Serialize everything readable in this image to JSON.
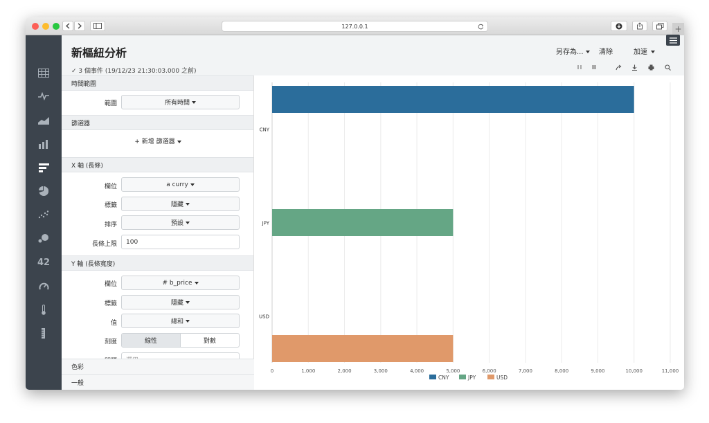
{
  "browser": {
    "url": "127.0.0.1",
    "back_icon": "chevron-left-icon",
    "forward_icon": "chevron-right-icon",
    "sidebar_icon": "sidebar-icon",
    "reload_icon": "reload-icon",
    "download_icon": "download-icon",
    "share_icon": "share-icon",
    "tabs_icon": "tabs-icon",
    "newtab_label": "+"
  },
  "nav": {
    "items": [
      {
        "icon": "table-icon"
      },
      {
        "icon": "line-chart-icon"
      },
      {
        "icon": "area-chart-icon"
      },
      {
        "icon": "column-chart-icon"
      },
      {
        "icon": "bar-chart-icon"
      },
      {
        "icon": "pie-chart-icon"
      },
      {
        "icon": "scatter-chart-icon"
      },
      {
        "icon": "bubble-chart-icon"
      },
      {
        "icon": "single-value-icon",
        "label": "42"
      },
      {
        "icon": "gauge-icon"
      },
      {
        "icon": "thermometer-icon"
      },
      {
        "icon": "marker-gauge-icon"
      }
    ]
  },
  "header": {
    "title": "新樞紐分析",
    "subtitle": "✓ 3 個事件 (19/12/23 21:30:03.000 之前)",
    "save_as": "另存為...",
    "clear": "清除",
    "accelerate": "加速",
    "menu_icon": "hamburger-icon",
    "tools": [
      "pause-icon",
      "stop-icon",
      "share-icon",
      "download-icon",
      "print-icon",
      "search-icon"
    ]
  },
  "panel": {
    "time_range_section": "時間範圍",
    "range_label": "範圍",
    "range_value": "所有時間",
    "filter_section": "篩選器",
    "add_filter": "+ 新增 篩選器",
    "x_section": "X 軸 (長條)",
    "x_field_label": "欄位",
    "x_field_value": "a curry",
    "x_label_label": "標籤",
    "x_label_value": "隱藏",
    "x_sort_label": "排序",
    "x_sort_value": "預設",
    "x_limit_label": "長條上限",
    "x_limit_value": "100",
    "y_section": "Y 軸 (長條寬度)",
    "y_field_label": "欄位",
    "y_field_value": "# b_price",
    "y_label_label": "標籤",
    "y_label_value": "隱藏",
    "y_value_label": "值",
    "y_value_value": "總和",
    "y_scale_label": "刻度",
    "y_scale_linear": "線性",
    "y_scale_log": "對數",
    "y_interval_label": "間隔",
    "y_interval_value": "選用",
    "color_section": "色彩",
    "general_section": "一般"
  },
  "chart_data": {
    "type": "bar",
    "orientation": "horizontal",
    "categories": [
      "CNY",
      "JPY",
      "USD"
    ],
    "values": [
      10000,
      5000,
      5000
    ],
    "colors": [
      "#2b6d9b",
      "#65a685",
      "#e0996a"
    ],
    "xlim": [
      0,
      11000
    ],
    "xticks": [
      "0",
      "1,000",
      "2,000",
      "3,000",
      "4,000",
      "5,000",
      "6,000",
      "7,000",
      "8,000",
      "9,000",
      "10,000",
      "11,000"
    ],
    "legend": [
      "CNY",
      "JPY",
      "USD"
    ],
    "legend_position": "bottom",
    "grid": true
  }
}
